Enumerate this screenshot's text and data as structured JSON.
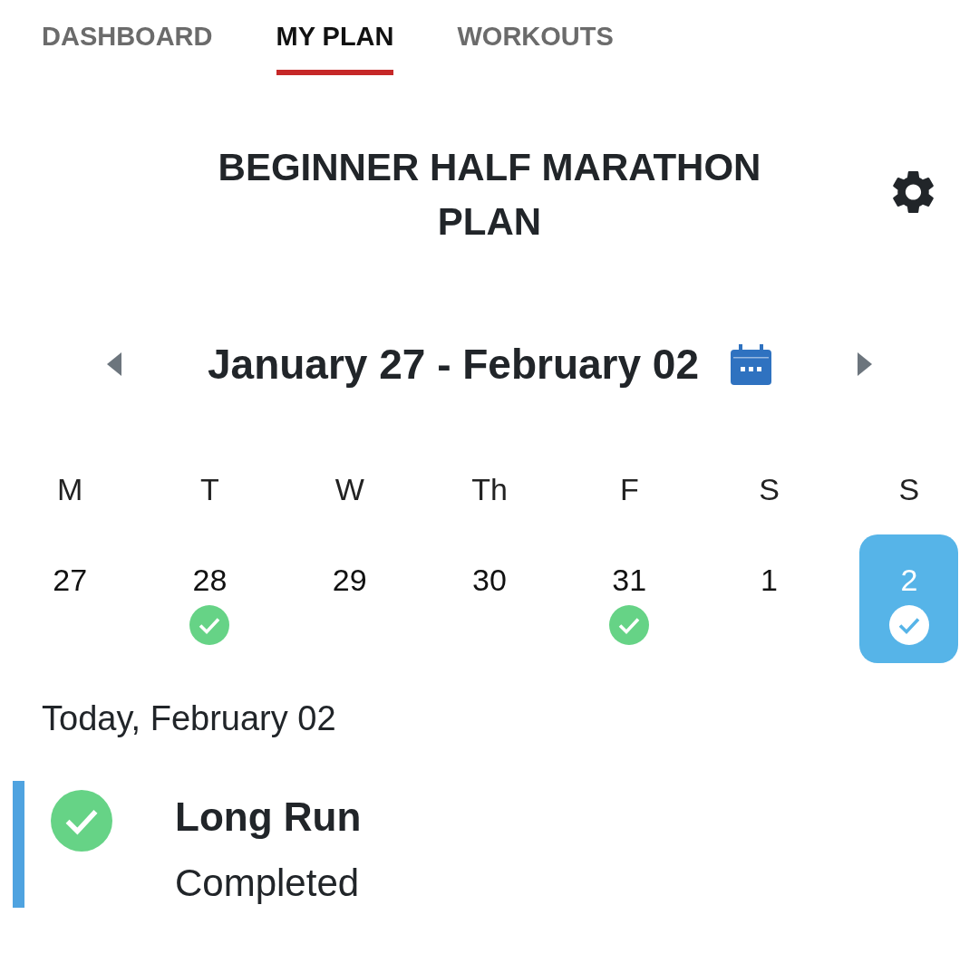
{
  "tabs": [
    {
      "label": "DASHBOARD",
      "selected": false
    },
    {
      "label": "MY PLAN",
      "selected": true
    },
    {
      "label": "WORKOUTS",
      "selected": false
    }
  ],
  "plan": {
    "title": "BEGINNER HALF MARATHON PLAN"
  },
  "week": {
    "range": "January 27 - February 02"
  },
  "weekdays": [
    "M",
    "T",
    "W",
    "Th",
    "F",
    "S",
    "S"
  ],
  "days": [
    {
      "date": "27",
      "completed": false,
      "selected": false
    },
    {
      "date": "28",
      "completed": true,
      "selected": false
    },
    {
      "date": "29",
      "completed": false,
      "selected": false
    },
    {
      "date": "30",
      "completed": false,
      "selected": false
    },
    {
      "date": "31",
      "completed": true,
      "selected": false
    },
    {
      "date": "1",
      "completed": false,
      "selected": false
    },
    {
      "date": "2",
      "completed": true,
      "selected": true
    }
  ],
  "today": {
    "heading": "Today, February 02"
  },
  "workouts": [
    {
      "name": "Long Run",
      "status": "Completed",
      "completed": true
    }
  ]
}
